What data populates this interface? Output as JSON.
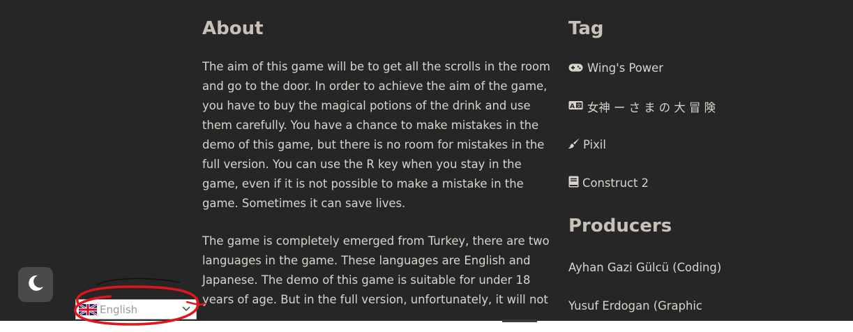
{
  "about": {
    "heading": "About",
    "paragraphs": [
      "The aim of this game will be to get all the scrolls in the room and go to the door. In order to achieve the aim of the game, you have to buy the magical potions of the drink and use them carefully. You have a chance to make mistakes in the demo of this game, but there is no room for mistakes in the full version. You can use the R key when you stay in the game, even if it is not possible to make a mistake in the game. Sometimes it can save lives.",
      "The game is completely emerged from Turkey, there are two languages in the game. These languages are English and Japanese. The demo of this game is suitable for under 18 years of age. But in the full version, unfortunately, it will not"
    ]
  },
  "tags": {
    "heading": "Tag",
    "items": [
      {
        "icon": "gamepad-icon",
        "label": "Wing's Power"
      },
      {
        "icon": "language-icon",
        "label": "女神 ー さ ま の 大 冒 険"
      },
      {
        "icon": "paint-brush-icon",
        "label": "Pixil"
      },
      {
        "icon": "book-icon",
        "label": "Construct 2"
      }
    ]
  },
  "producers": {
    "heading": "Producers",
    "items": [
      "Ayhan Gazi Gülcü (Coding)",
      "Yusuf Erdogan (Graphic"
    ]
  },
  "language_selector": {
    "selected": "English",
    "flag": "uk-flag-icon"
  },
  "theme_toggle": {
    "icon": "moon-icon"
  },
  "colors": {
    "background": "#262626",
    "text": "#d9d4cc",
    "annotation": "#e0161e"
  }
}
